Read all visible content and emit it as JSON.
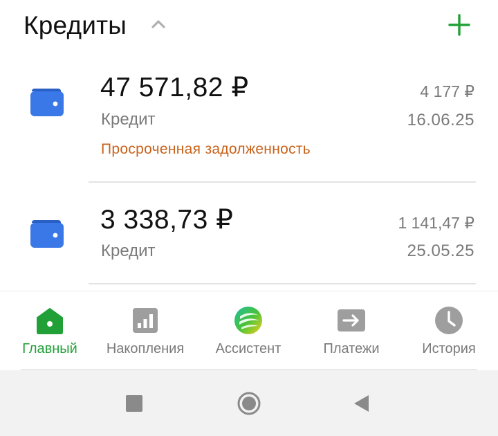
{
  "header": {
    "title": "Кредиты"
  },
  "credits": [
    {
      "amount": "47 571,82 ₽",
      "type": "Кредит",
      "status": "Просроченная задолженность",
      "payment": "4 177 ₽",
      "date": "16.06.25"
    },
    {
      "amount": "3 338,73 ₽",
      "type": "Кредит",
      "payment": "1 141,47 ₽",
      "date": "25.05.25"
    }
  ],
  "bottom_nav": [
    {
      "label": "Главный",
      "icon": "home-icon",
      "active": true
    },
    {
      "label": "Накопления",
      "icon": "savings-chart-icon"
    },
    {
      "label": "Ассистент",
      "icon": "assistant-logo-icon"
    },
    {
      "label": "Платежи",
      "icon": "payments-arrow-icon"
    },
    {
      "label": "История",
      "icon": "clock-icon"
    }
  ],
  "colors": {
    "accent_green": "#21a038",
    "wallet_blue": "#3a78e8",
    "overdue_orange": "#c8621a",
    "secondary_text": "#7a7a7a"
  },
  "system_nav": [
    "recent-apps-icon",
    "home-circle-icon",
    "back-icon"
  ]
}
